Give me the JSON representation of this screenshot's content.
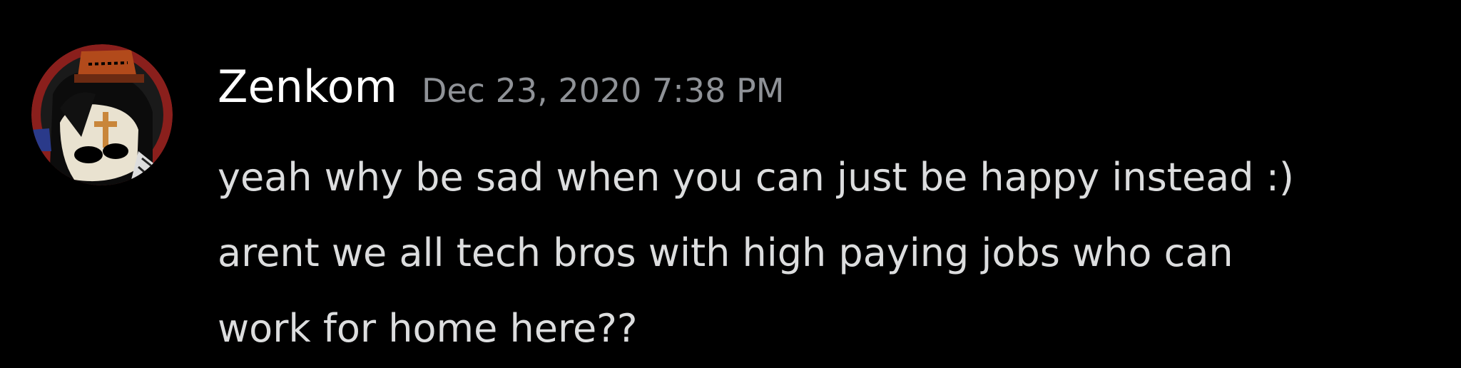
{
  "message": {
    "author": "Zenkom",
    "timestamp": "Dec 23, 2020 7:38 PM",
    "lines": [
      "yeah why be sad when you can just be happy instead :)",
      "arent we all tech bros with high paying jobs who can",
      "work for home here??"
    ]
  },
  "colors": {
    "background": "#000000",
    "author": "#ffffff",
    "timestamp": "#8f9297",
    "text": "#dcddde"
  },
  "icons": {
    "avatar": "user-avatar-drawing"
  }
}
